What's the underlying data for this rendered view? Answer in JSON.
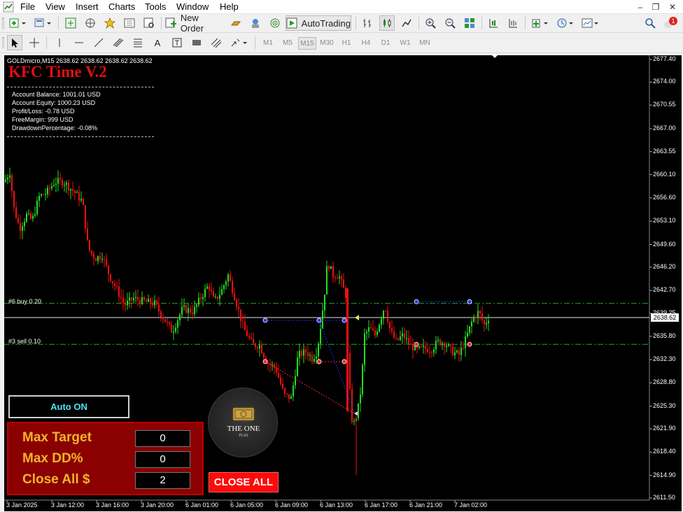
{
  "menu": [
    "File",
    "View",
    "Insert",
    "Charts",
    "Tools",
    "Window",
    "Help"
  ],
  "toolbar": {
    "new_order": "New Order",
    "autotrading": "AutoTrading",
    "notification_count": "1",
    "timeframes": [
      "M1",
      "M5",
      "M15",
      "M30",
      "H1",
      "H4",
      "D1",
      "W1",
      "MN"
    ],
    "active_timeframe": "M15",
    "text_tool": "A"
  },
  "chart": {
    "symbol_line": "GOLDmicro,M15  2638.62 2638.62 2638.62 2638.62",
    "ea_title": "KFC Time V.2",
    "account": {
      "balance": "Account Balance: 1001.01 USD",
      "equity": "Account Equity: 1000.23 USD",
      "pl": "Profit/Loss: -0.78 USD",
      "free_margin": "FreeMargin: 999 USD",
      "drawdown": "DrawdownPercentage: -0.08%"
    },
    "order_labels": {
      "buy": "#6 buy 0.20",
      "sell": "#3 sell 0.10"
    },
    "bid_price": "2638.62",
    "price_ticks": [
      "2677.40",
      "2674.00",
      "2670.55",
      "2667.00",
      "2663.55",
      "2660.10",
      "2656.60",
      "2653.10",
      "2649.60",
      "2646.20",
      "2642.70",
      "2639.25",
      "2635.80",
      "2632.30",
      "2628.80",
      "2625.30",
      "2621.90",
      "2618.40",
      "2614.90",
      "2611.50"
    ],
    "time_ticks": [
      "3 Jan 2025",
      "3 Jan 12:00",
      "3 Jan 16:00",
      "3 Jan 20:00",
      "6 Jan 01:00",
      "6 Jan 05:00",
      "6 Jan 09:00",
      "6 Jan 13:00",
      "6 Jan 17:00",
      "6 Jan 21:00",
      "7 Jan 02:00"
    ],
    "colors": {
      "background": "#000000",
      "bull": "#22dd22",
      "bear": "#ee1111",
      "grid_level": "#22aa22",
      "buy_marker": "#2233ff",
      "sell_marker": "#ff2222"
    }
  },
  "panel": {
    "auto_button": "Auto ON",
    "max_target_label": "Max Target",
    "max_target_value": "0",
    "max_dd_label": "Max DD%",
    "max_dd_value": "0",
    "close_all_label": "Close All $",
    "close_all_value": "2",
    "close_all_button": "CLOSE ALL",
    "logo_text": "THE ONE",
    "logo_sub": "PLUS"
  }
}
